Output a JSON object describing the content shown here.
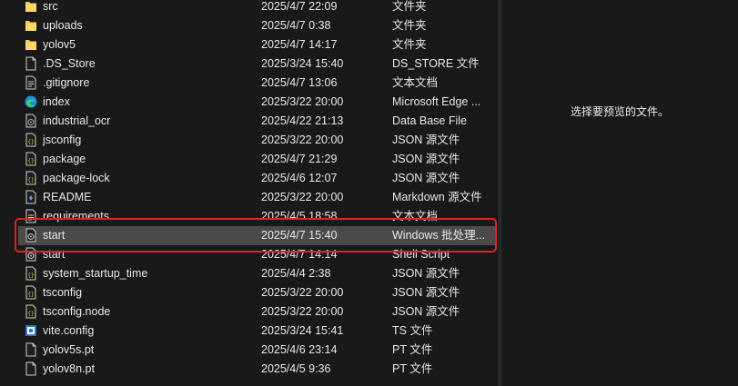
{
  "preview": {
    "message": "选择要预览的文件。"
  },
  "files": [
    {
      "name": "src",
      "date": "2025/4/7 22:09",
      "type": "文件夹",
      "icon": "folder-icon",
      "selected": false
    },
    {
      "name": "uploads",
      "date": "2025/4/7 0:38",
      "type": "文件夹",
      "icon": "folder-icon",
      "selected": false
    },
    {
      "name": "yolov5",
      "date": "2025/4/7 14:17",
      "type": "文件夹",
      "icon": "folder-icon",
      "selected": false
    },
    {
      "name": ".DS_Store",
      "date": "2025/3/24 15:40",
      "type": "DS_STORE 文件",
      "icon": "file-icon",
      "selected": false
    },
    {
      "name": ".gitignore",
      "date": "2025/4/7 13:06",
      "type": "文本文档",
      "icon": "text-file-icon",
      "selected": false
    },
    {
      "name": "index",
      "date": "2025/3/22 20:00",
      "type": "Microsoft Edge ...",
      "icon": "edge-icon",
      "selected": false
    },
    {
      "name": "industrial_ocr",
      "date": "2025/4/22 21:13",
      "type": "Data Base File",
      "icon": "database-file-icon",
      "selected": false
    },
    {
      "name": "jsconfig",
      "date": "2025/3/22 20:00",
      "type": "JSON 源文件",
      "icon": "json-file-icon",
      "selected": false
    },
    {
      "name": "package",
      "date": "2025/4/7 21:29",
      "type": "JSON 源文件",
      "icon": "json-file-icon",
      "selected": false
    },
    {
      "name": "package-lock",
      "date": "2025/4/6 12:07",
      "type": "JSON 源文件",
      "icon": "json-file-icon",
      "selected": false
    },
    {
      "name": "README",
      "date": "2025/3/22 20:00",
      "type": "Markdown 源文件",
      "icon": "markdown-file-icon",
      "selected": false
    },
    {
      "name": "requirements",
      "date": "2025/4/5 18:58",
      "type": "文本文档",
      "icon": "text-file-icon",
      "selected": false
    },
    {
      "name": "start",
      "date": "2025/4/7 15:40",
      "type": "Windows 批处理...",
      "icon": "batch-file-icon",
      "selected": true
    },
    {
      "name": "start",
      "date": "2025/4/7 14:14",
      "type": "Shell Script",
      "icon": "shell-script-icon",
      "selected": false
    },
    {
      "name": "system_startup_time",
      "date": "2025/4/4 2:38",
      "type": "JSON 源文件",
      "icon": "json-file-icon",
      "selected": false
    },
    {
      "name": "tsconfig",
      "date": "2025/3/22 20:00",
      "type": "JSON 源文件",
      "icon": "json-file-icon",
      "selected": false
    },
    {
      "name": "tsconfig.node",
      "date": "2025/3/22 20:00",
      "type": "JSON 源文件",
      "icon": "json-file-icon",
      "selected": false
    },
    {
      "name": "vite.config",
      "date": "2025/3/24 15:41",
      "type": "TS 文件",
      "icon": "typescript-file-icon",
      "selected": false
    },
    {
      "name": "yolov5s.pt",
      "date": "2025/4/6 23:14",
      "type": "PT 文件",
      "icon": "file-icon",
      "selected": false
    },
    {
      "name": "yolov8n.pt",
      "date": "2025/4/5 9:36",
      "type": "PT 文件",
      "icon": "file-icon",
      "selected": false
    }
  ]
}
